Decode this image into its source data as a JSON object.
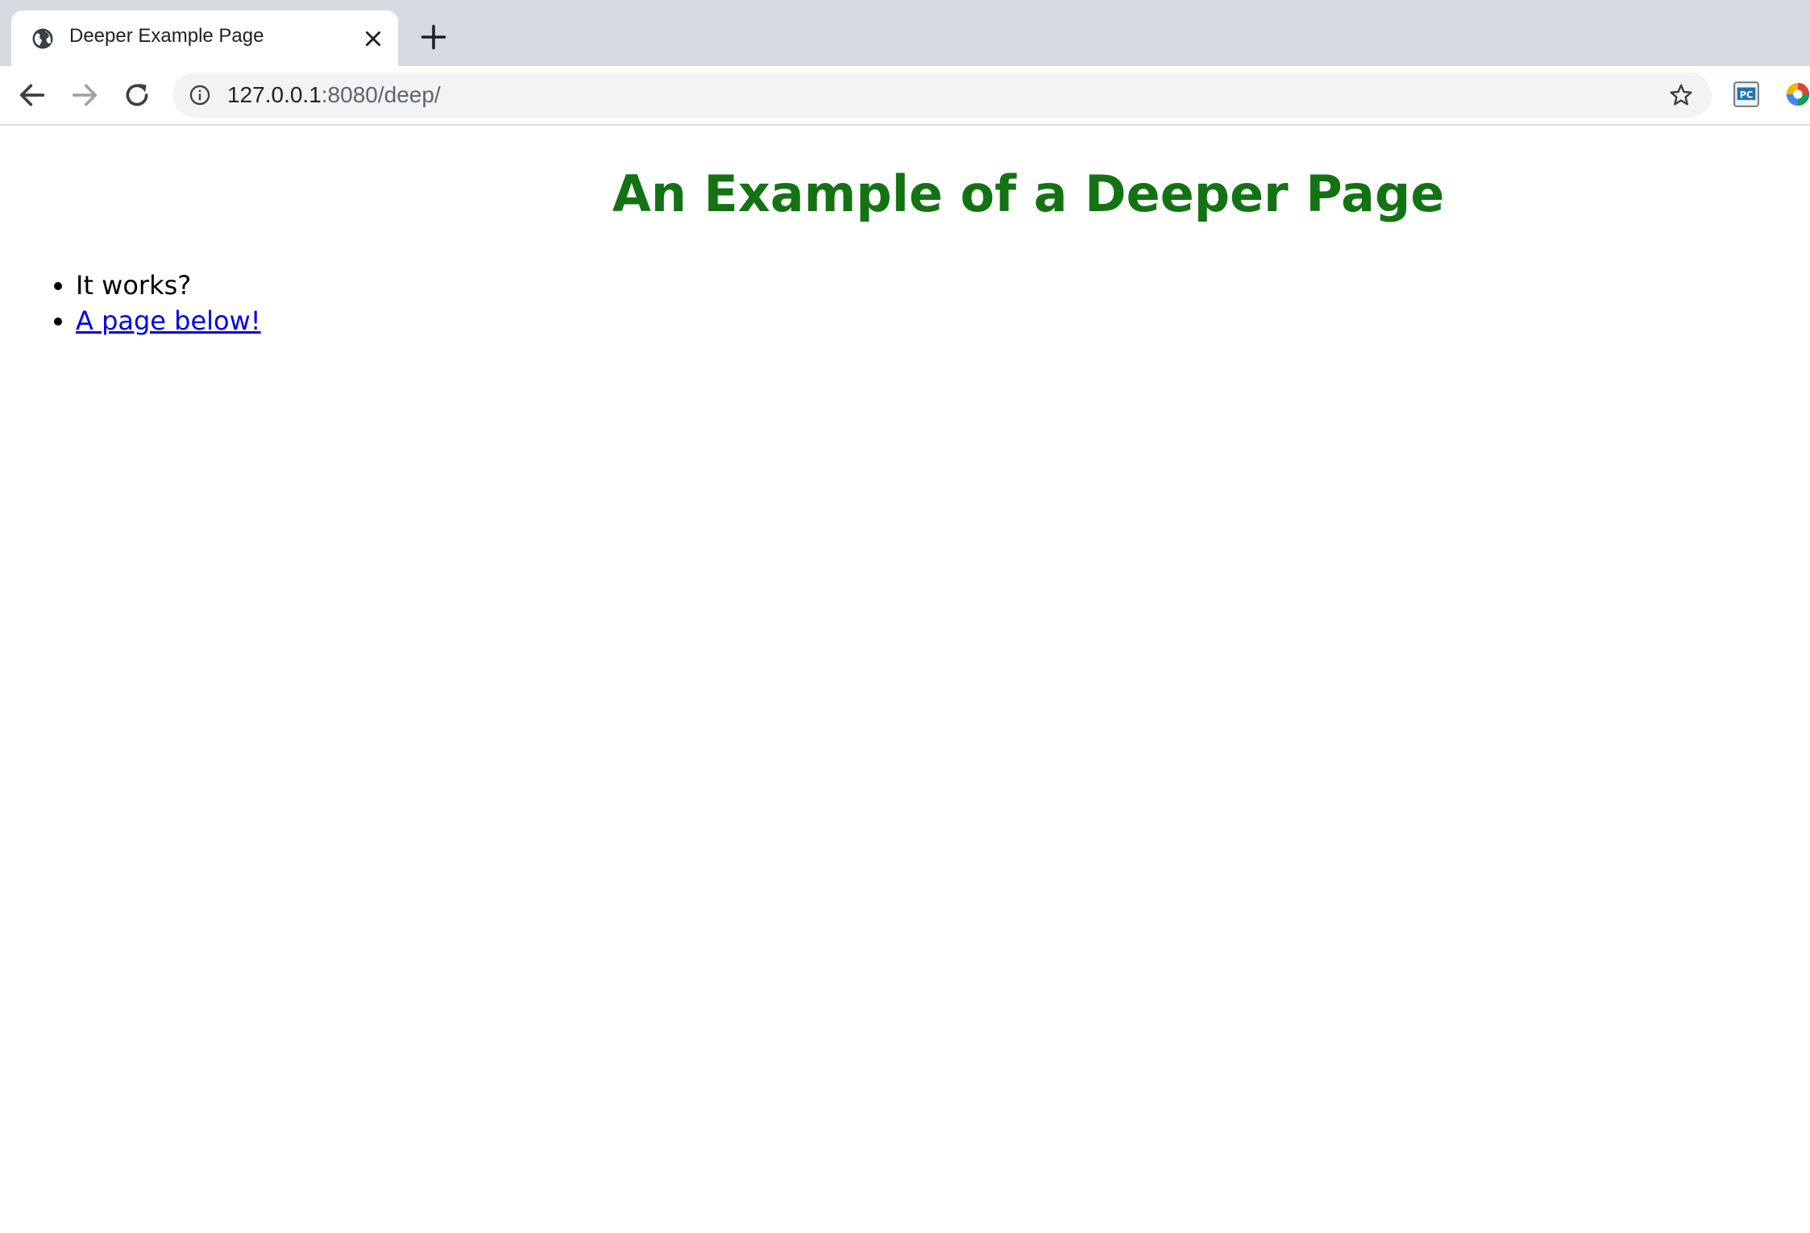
{
  "browser": {
    "tab": {
      "title": "Deeper Example Page",
      "favicon": "globe-icon"
    },
    "toolbar": {
      "url_host": "127.0.0.1",
      "url_rest": ":8080/deep/",
      "icons": [
        "back-arrow-icon",
        "forward-arrow-icon",
        "reload-icon",
        "info-icon",
        "star-icon",
        "pycharm-extension-icon",
        "color-extension-icon"
      ]
    }
  },
  "page": {
    "heading": "An Example of a Deeper Page",
    "heading_color": "#137313",
    "items": [
      {
        "text": "It works?"
      },
      {
        "link_text": "A page below!"
      }
    ]
  },
  "colors": {
    "tabstrip": "#d7dae0",
    "omnibox": "#f1f3f4",
    "link": "#0000ee"
  }
}
